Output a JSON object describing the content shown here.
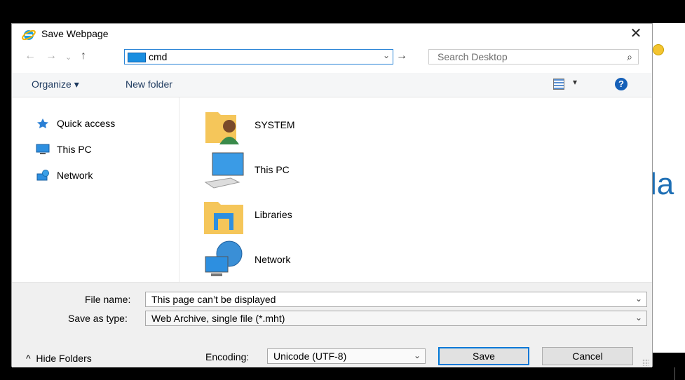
{
  "window": {
    "title": "Save Webpage",
    "close": "✕"
  },
  "address": {
    "value": "cmd"
  },
  "search": {
    "placeholder": "Search Desktop"
  },
  "toolbar": {
    "organize": "Organize ▾",
    "new_folder": "New folder",
    "view_drop": "▾",
    "help": "?"
  },
  "navigation_pane": {
    "items": [
      {
        "label": "Quick access",
        "icon": "star-pin-icon"
      },
      {
        "label": "This PC",
        "icon": "computer-icon"
      },
      {
        "label": "Network",
        "icon": "network-icon"
      }
    ]
  },
  "files": [
    {
      "label": "SYSTEM",
      "icon": "user-folder-icon"
    },
    {
      "label": "This PC",
      "icon": "computer-icon"
    },
    {
      "label": "Libraries",
      "icon": "libraries-icon"
    },
    {
      "label": "Network",
      "icon": "network-globe-icon"
    }
  ],
  "form": {
    "file_name_label": "File name:",
    "file_name_value": "This page can’t be displayed",
    "save_type_label": "Save as type:",
    "save_type_value": "Web Archive, single file (*.mht)",
    "encoding_label": "Encoding:",
    "encoding_value": "Unicode (UTF-8)"
  },
  "buttons": {
    "save": "Save",
    "cancel": "Cancel",
    "hide_folders": "Hide Folders"
  },
  "colors": {
    "accent": "#0078d7",
    "help": "#1560b8"
  }
}
